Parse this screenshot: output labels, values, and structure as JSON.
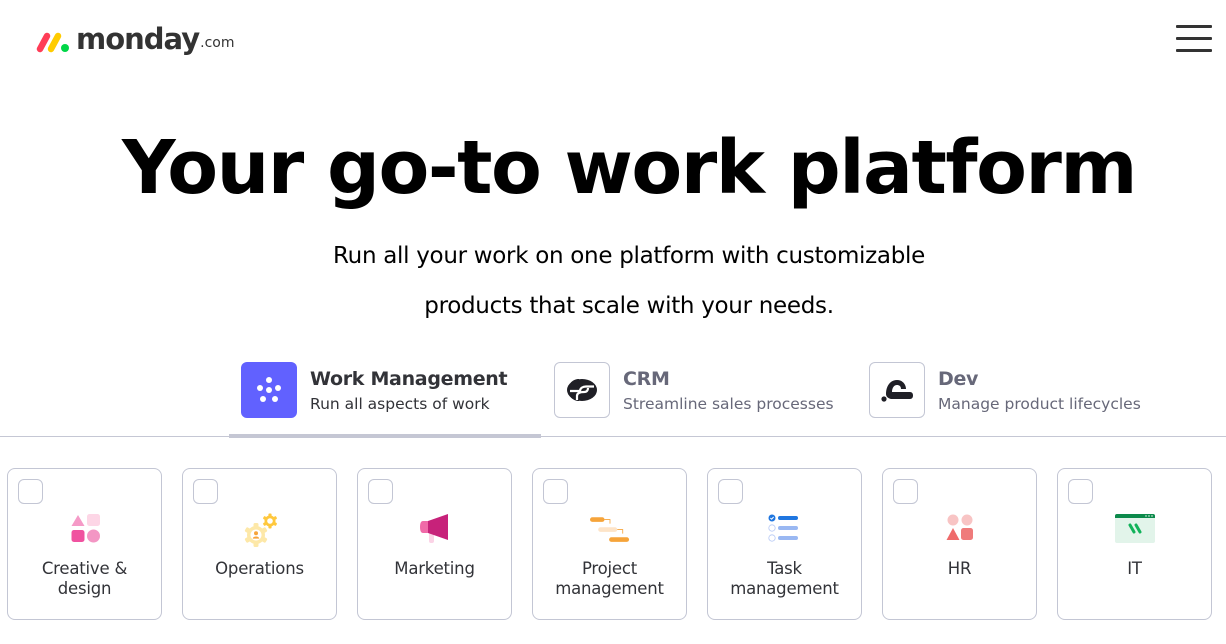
{
  "header": {
    "logo_text": "monday",
    "logo_suffix": ".com",
    "logo_colors": [
      "#ff3d57",
      "#ffcb00",
      "#00d647"
    ],
    "menu_icon": "hamburger-menu-icon"
  },
  "hero": {
    "title": "Your go-to work platform",
    "subtitle_line1": "Run all your work on one platform with customizable",
    "subtitle_line2": "products that scale with your needs."
  },
  "products": {
    "selected": "Work Management",
    "items": [
      {
        "name": "Work Management",
        "description": "Run all aspects of work",
        "icon": "work-management-dots-icon",
        "active": true,
        "color": "#6161ff"
      },
      {
        "name": "CRM",
        "description": "Streamline sales processes",
        "icon": "crm-icon",
        "active": false
      },
      {
        "name": "Dev",
        "description": "Manage product lifecycles",
        "icon": "dev-icon",
        "active": false
      }
    ]
  },
  "use_cases": {
    "items": [
      {
        "label": "Creative &\ndesign",
        "icon": "shapes-icon",
        "checked": false
      },
      {
        "label": "Operations",
        "icon": "gears-icon",
        "checked": false
      },
      {
        "label": "Marketing",
        "icon": "megaphone-icon",
        "checked": false
      },
      {
        "label": "Project\nmanagement",
        "icon": "gantt-icon",
        "checked": false
      },
      {
        "label": "Task\nmanagement",
        "icon": "checklist-icon",
        "checked": false
      },
      {
        "label": "HR",
        "icon": "people-shapes-icon",
        "checked": false
      },
      {
        "label": "IT",
        "icon": "browser-window-icon",
        "checked": false
      }
    ]
  }
}
